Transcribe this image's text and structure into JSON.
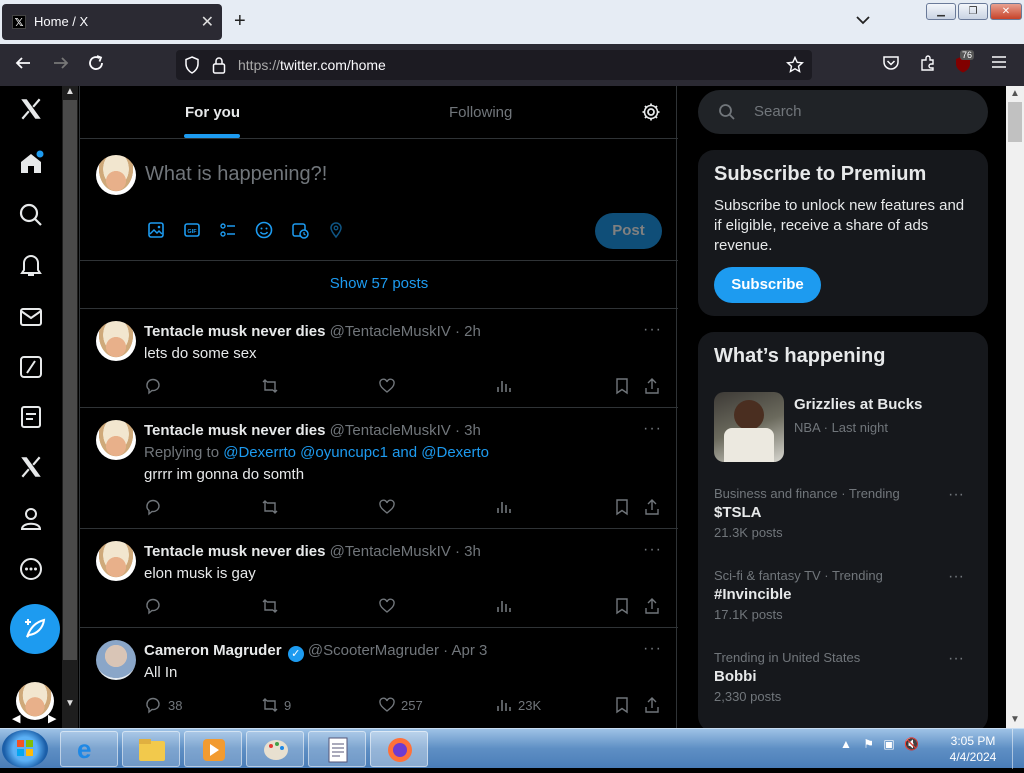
{
  "browser": {
    "tab_title": "Home / X",
    "tab_close": "✕",
    "new_tab": "+",
    "list_tabs": "⌄",
    "url_prefix": "https://",
    "url_host": "twitter.com/home",
    "extension_badge": "76",
    "win_min": "▁",
    "win_max": "❐",
    "win_close": "✕"
  },
  "timeline_tabs": {
    "for_you": "For you",
    "following": "Following"
  },
  "composer": {
    "placeholder": "What is happening?!",
    "post_label": "Post"
  },
  "show_posts": "Show 57 posts",
  "tweets": [
    {
      "name": "Tentacle musk never dies",
      "handle": "@TentacleMuskIV",
      "time": "· 2h",
      "text": "lets do  some sex",
      "more": "···"
    },
    {
      "name": "Tentacle musk never dies",
      "handle": "@TentacleMuskIV",
      "time": "· 3h",
      "reply_prefix": "Replying to",
      "reply_to": "@Dexerrto @oyuncupc1 and @Dexerto",
      "text": "grrrr im gonna do somth",
      "more": "···"
    },
    {
      "name": "Tentacle musk never dies",
      "handle": "@TentacleMuskIV",
      "time": "· 3h",
      "text": "elon musk is gay",
      "more": "···"
    },
    {
      "name": "Cameron Magruder",
      "handle": "@ScooterMagruder",
      "time": "· Apr 3",
      "text": "All In",
      "replies": "38",
      "reposts": "9",
      "likes": "257",
      "views": "23K",
      "more": "···"
    }
  ],
  "search": {
    "placeholder": "Search"
  },
  "premium": {
    "title": "Subscribe to Premium",
    "description": "Subscribe to unlock new features and if eligible, receive a share of ads revenue.",
    "button": "Subscribe"
  },
  "whats_happening": {
    "title": "What’s happening",
    "event": {
      "title": "Grizzlies at Bucks",
      "context": "NBA · Last night"
    },
    "trends": [
      {
        "context": "Business and finance · Trending",
        "title": "$TSLA",
        "count": "21.3K posts"
      },
      {
        "context": "Sci-fi & fantasy TV · Trending",
        "title": "#Invincible",
        "count": "17.1K posts"
      },
      {
        "context": "Trending in United States",
        "title": "Bobbi",
        "count": "2,330 posts"
      }
    ]
  },
  "taskbar": {
    "time": "3:05 PM",
    "date": "4/4/2024"
  },
  "colors": {
    "accent": "#1d9bf0",
    "background": "#000000",
    "text": "#e7e9ea",
    "muted": "#71767b"
  }
}
